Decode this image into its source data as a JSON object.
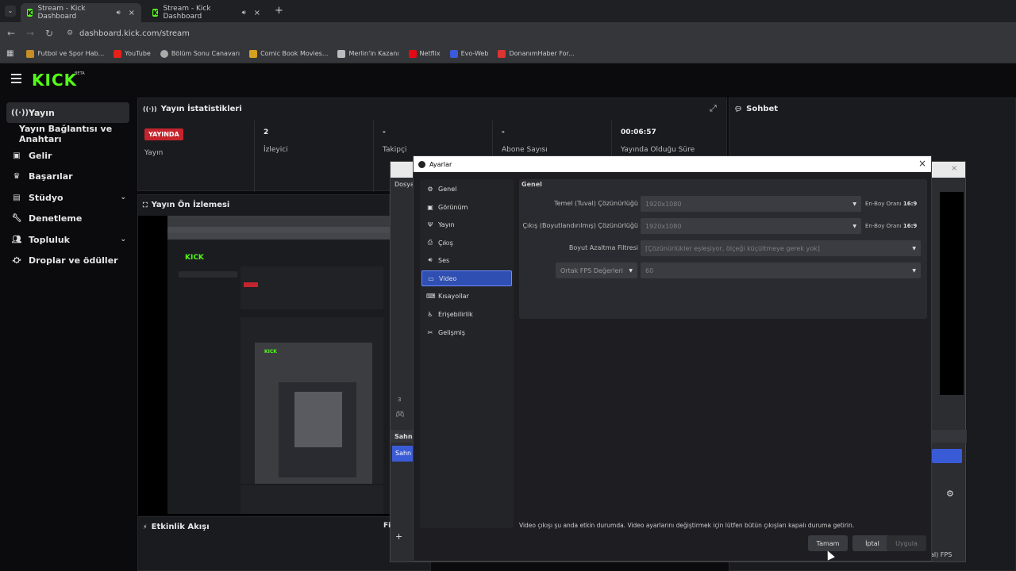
{
  "browser": {
    "tabs": [
      {
        "title": "Stream - Kick Dashboard",
        "audio_icon": "speaker-icon",
        "close": "×"
      },
      {
        "title": "Stream - Kick Dashboard",
        "audio_icon": "speaker-icon",
        "close": "×"
      }
    ],
    "new_tab": "+",
    "url": "dashboard.kick.com/stream",
    "bookmarks": [
      "Futbol ve Spor Hab...",
      "YouTube",
      "Bölüm Sonu Canavarı",
      "Comic Book Movies...",
      "Merlin'in Kazanı",
      "Netflix",
      "Evo-Web",
      "DonanımHaber For..."
    ]
  },
  "kick": {
    "logo": "KICK",
    "beta": "BETA",
    "sidebar": [
      {
        "label": "Yayın",
        "icon": "broadcast-icon"
      },
      {
        "label": "Yayın Bağlantısı ve Anahtarı"
      },
      {
        "label": "Gelir",
        "icon": "wallet-icon"
      },
      {
        "label": "Başarılar",
        "icon": "trophy-icon"
      },
      {
        "label": "Stüdyo",
        "icon": "studio-icon"
      },
      {
        "label": "Denetleme",
        "icon": "wrench-icon"
      },
      {
        "label": "Topluluk",
        "icon": "people-icon"
      },
      {
        "label": "Droplar ve ödüller",
        "icon": "gift-icon"
      }
    ],
    "stats_panel": {
      "title": "Yayın İstatistikleri",
      "live_badge": "YAYINDA",
      "live_label": "Yayın",
      "stats": [
        {
          "value": "2",
          "label": "İzleyici"
        },
        {
          "value": "-",
          "label": "Takipçi"
        },
        {
          "value": "-",
          "label": "Abone Sayısı"
        },
        {
          "value": "00:06:57",
          "label": "Yayında Olduğu Süre"
        }
      ]
    },
    "preview_title": "Yayın Ön İzlemesi",
    "events_title": "Etkinlik Akışı",
    "chat_title": "Sohbet"
  },
  "obs_bg": {
    "menu_label": "Dosya",
    "scenes_label": "Sahne",
    "scene_item": "Sahn",
    "fps_text": "al) FPS",
    "misc_label": "Fi",
    "misc_num": "3"
  },
  "dialog": {
    "title": "Ayarlar",
    "close": "×",
    "categories": [
      {
        "label": "Genel",
        "icon": "gear-icon"
      },
      {
        "label": "Görünüm",
        "icon": "monitor-icon"
      },
      {
        "label": "Yayın",
        "icon": "antenna-icon"
      },
      {
        "label": "Çıkış",
        "icon": "output-icon"
      },
      {
        "label": "Ses",
        "icon": "speaker-icon"
      },
      {
        "label": "Video",
        "icon": "display-icon"
      },
      {
        "label": "Kısayollar",
        "icon": "keyboard-icon"
      },
      {
        "label": "Erişebilirlik",
        "icon": "accessibility-icon"
      },
      {
        "label": "Gelişmiş",
        "icon": "tools-icon"
      }
    ],
    "section": "Genel",
    "base_res_label": "Temel (Tuval) Çözünürlüğü",
    "base_res_value": "1920x1080",
    "output_res_label": "Çıkış (Boyutlandırılmış) Çözünürlüğü",
    "output_res_value": "1920x1080",
    "aspect_label": "En-Boy Oranı",
    "aspect_value": "16:9",
    "filter_label": "Boyut Azaltma Filtresi",
    "filter_value": "[Çözünürlükler eşleşiyor, ölçeği küçültmeye gerek yok]",
    "fps_type": "Ortak FPS Değerleri",
    "fps_value": "60",
    "notice": "Video çıkışı şu anda etkin durumda. Video ayarlarını değiştirmek için lütfen bütün çıkışları kapalı duruma getirin.",
    "buttons": {
      "ok": "Tamam",
      "cancel": "İptal",
      "apply": "Uygula"
    }
  }
}
